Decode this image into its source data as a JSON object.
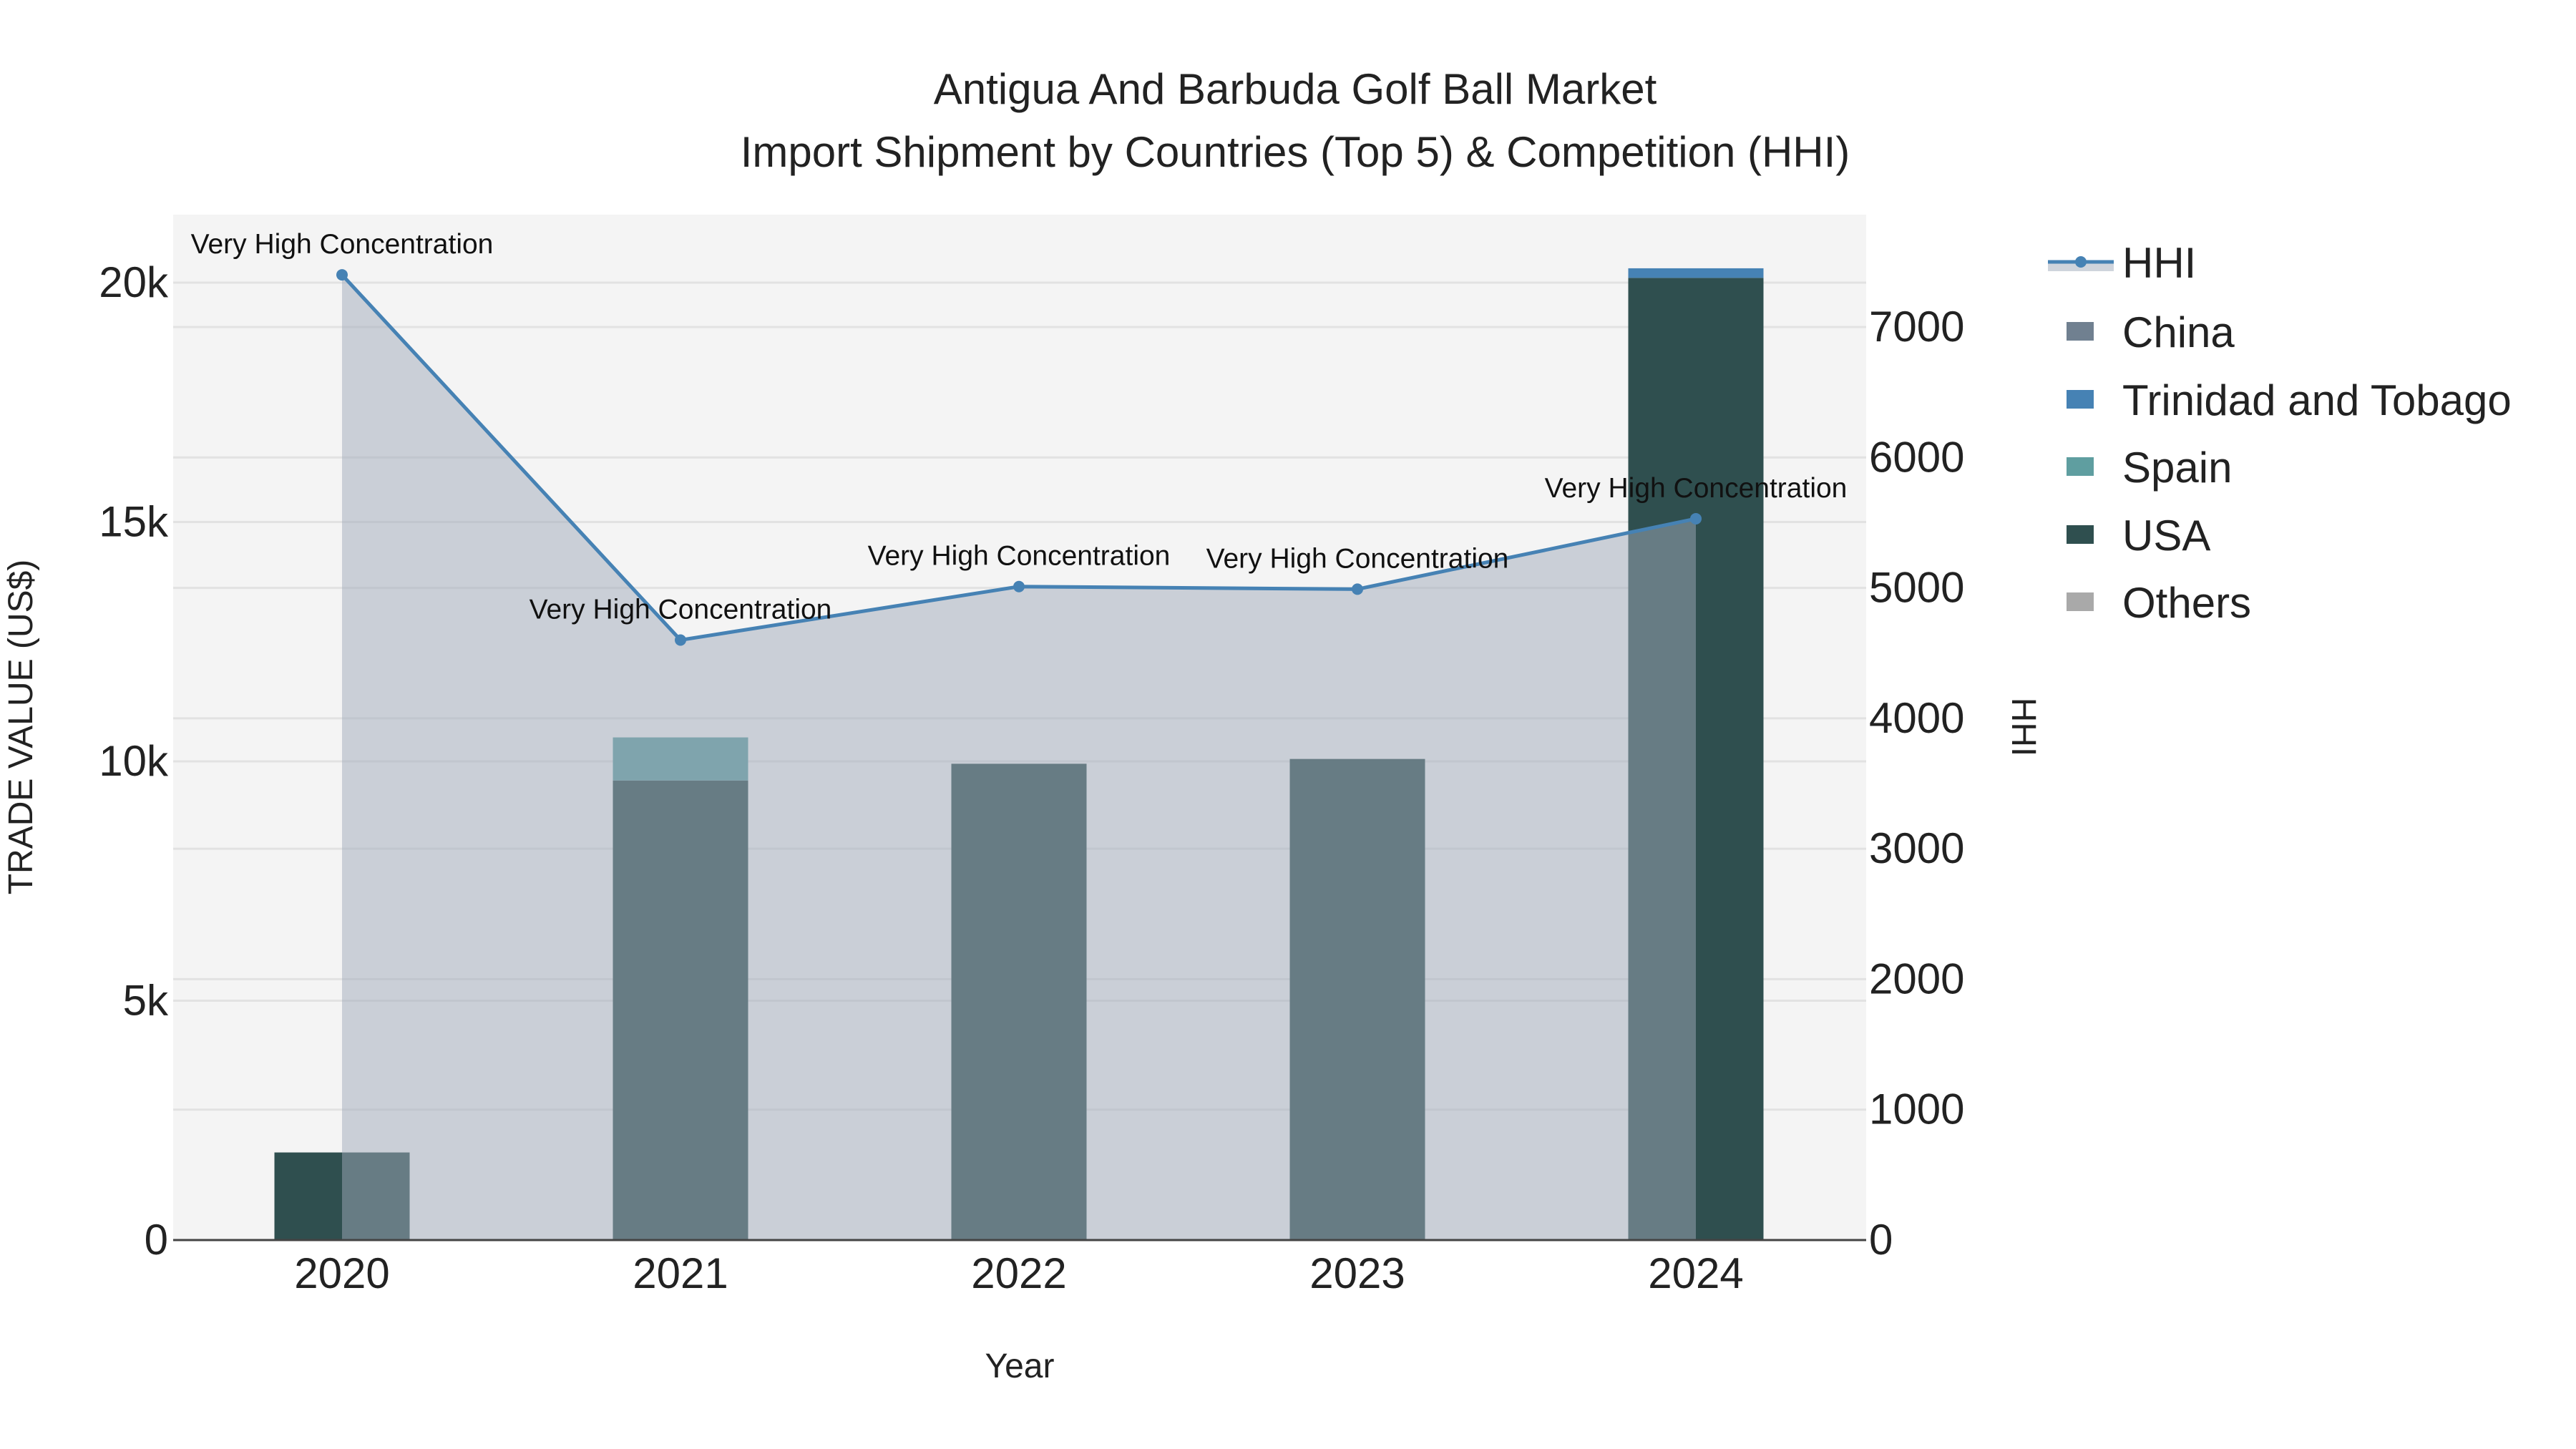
{
  "chart_data": {
    "type": "bar",
    "title": "Antigua And Barbuda Golf Ball Market",
    "subtitle": "Import Shipment by Countries (Top 5) & Competition (HHI)",
    "xlabel": "Year",
    "ylabel": "TRADE VALUE (US$)",
    "y2label": "HHI",
    "categories": [
      "2020",
      "2021",
      "2022",
      "2023",
      "2024"
    ],
    "ylim": [
      0,
      21300
    ],
    "y2lim": [
      0,
      7900
    ],
    "yticks": [
      0,
      5000,
      10000,
      15000,
      20000
    ],
    "ytick_labels": [
      "0",
      "5k",
      "10k",
      "15k",
      "20k"
    ],
    "y2ticks": [
      0,
      1000,
      2000,
      3000,
      4000,
      5000,
      6000,
      7000
    ],
    "y2tick_labels": [
      "0",
      "1000",
      "2000",
      "3000",
      "4000",
      "5000",
      "6000",
      "7000"
    ],
    "barmode": "stack",
    "series": [
      {
        "name": "China",
        "color": "#708090",
        "values": [
          0,
          0,
          0,
          0,
          0
        ]
      },
      {
        "name": "Trinidad and Tobago",
        "color": "#4682b4",
        "values": [
          0,
          0,
          0,
          0,
          200
        ]
      },
      {
        "name": "Spain",
        "color": "#5f9ea0",
        "values": [
          0,
          900,
          0,
          0,
          0
        ]
      },
      {
        "name": "USA",
        "color": "#2f4f4f",
        "values": [
          1830,
          9600,
          9950,
          10050,
          20100
        ]
      },
      {
        "name": "Others",
        "color": "#a9a9a9",
        "values": [
          0,
          0,
          0,
          0,
          0
        ]
      }
    ],
    "hhi": {
      "name": "HHI",
      "color": "#4682b4",
      "values": [
        7400,
        4600,
        5010,
        4990,
        5530
      ],
      "annotations": [
        "Very High Concentration",
        "Very High Concentration",
        "Very High Concentration",
        "Very High Concentration",
        "Very High Concentration"
      ]
    },
    "legend": [
      "HHI",
      "China",
      "Trinidad and Tobago",
      "Spain",
      "USA",
      "Others"
    ],
    "legend_position": "right",
    "grid": true
  }
}
